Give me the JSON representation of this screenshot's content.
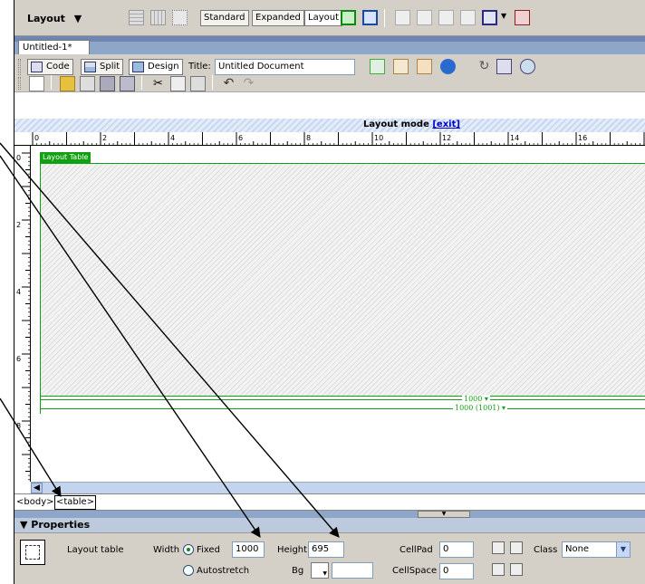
{
  "insert_bar": {
    "category": "Layout",
    "standard": "Standard",
    "expanded": "Expanded",
    "layout": "Layout"
  },
  "document": {
    "tab": "Untitled-1*",
    "code": "Code",
    "split": "Split",
    "design": "Design",
    "title_label": "Title:",
    "title_value": "Untitled Document"
  },
  "layout_mode": {
    "text": "Layout mode",
    "exit": "[exit]"
  },
  "ruler": {
    "h_ticks": [
      "0",
      "2",
      "4",
      "6",
      "8",
      "10",
      "12",
      "14",
      "16"
    ],
    "v_ticks": [
      "0",
      "2",
      "4",
      "6",
      "8"
    ]
  },
  "canvas": {
    "tab_label": "Layout Table",
    "width_indicator": "1000",
    "width_indicator_full": "1000 (1001)"
  },
  "tag_selector": {
    "body": "<body>",
    "table": "<table>"
  },
  "properties": {
    "title": "Properties",
    "kind": "Layout table",
    "width_label": "Width",
    "fixed": "Fixed",
    "width_value": "1000",
    "autostretch": "Autostretch",
    "height_label": "Height",
    "height_value": "695",
    "bg_label": "Bg",
    "cellpad_label": "CellPad",
    "cellpad_value": "0",
    "cellspace_label": "CellSpace",
    "cellspace_value": "0",
    "class_label": "Class",
    "class_value": "None"
  },
  "colors": {
    "layout_green": "#11a011",
    "toolbar": "#d4d0c8",
    "link": "#0000cc"
  }
}
